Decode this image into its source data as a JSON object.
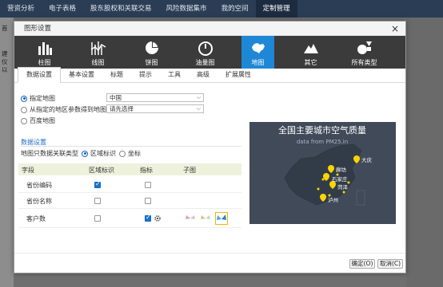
{
  "topnav": {
    "items": [
      "营资分析",
      "电子表格",
      "股东股权和关联交易",
      "风险数据集市",
      "我的空间",
      "定制管理"
    ],
    "active_index": 5
  },
  "left_strip": {
    "texts": [
      "首",
      "建",
      "仪",
      "以"
    ]
  },
  "dialog": {
    "title": "图形设置",
    "close_symbol": "×",
    "chart_types": [
      {
        "label": "柱图",
        "icon": "bar-chart-icon"
      },
      {
        "label": "线图",
        "icon": "line-chart-icon"
      },
      {
        "label": "饼图",
        "icon": "pie-chart-icon"
      },
      {
        "label": "油量图",
        "icon": "gauge-icon"
      },
      {
        "label": "地图",
        "icon": "map-icon"
      },
      {
        "label": "其它",
        "icon": "mountain-icon"
      },
      {
        "label": "所有类型",
        "icon": "shapes-icon"
      }
    ],
    "active_type_index": 4,
    "tabs": [
      "数据设置",
      "基本设置",
      "标题",
      "提示",
      "工具",
      "高级",
      "扩展属性"
    ],
    "active_tab_index": 0,
    "map_source": {
      "option1": "指定地图",
      "option1_value": "中国",
      "option2": "从指定的地区参数得到地图",
      "option2_value": "请先选择",
      "option3": "百度地图",
      "selected": 0
    },
    "data_section": {
      "title": "数据设置",
      "data_type_label": "地图只数据关联类型",
      "radio_a": "区域标识",
      "radio_b": "坐标",
      "selected": 0
    },
    "grid": {
      "headers": [
        "字段",
        "区域标识",
        "指标",
        "子图"
      ],
      "rows": [
        {
          "field": "省份编码",
          "region": true,
          "metric": false,
          "has_gear": false,
          "has_subicons": false
        },
        {
          "field": "省份名称",
          "region": false,
          "metric": false,
          "has_gear": false,
          "has_subicons": false
        },
        {
          "field": "客户数",
          "region": false,
          "metric": true,
          "has_gear": true,
          "has_subicons": true
        }
      ]
    },
    "map_preview": {
      "title": "全国主要城市空气质量",
      "subtitle": "data from PM25.in",
      "labels": [
        "大庆",
        "廊坊",
        "石家庄",
        "菏泽",
        "泸州"
      ],
      "background_color": "#404a59",
      "land_color": "#323c48",
      "point_color": "#ffd400"
    },
    "buttons": {
      "ok": "确定(O)",
      "cancel": "取消(C)"
    }
  }
}
